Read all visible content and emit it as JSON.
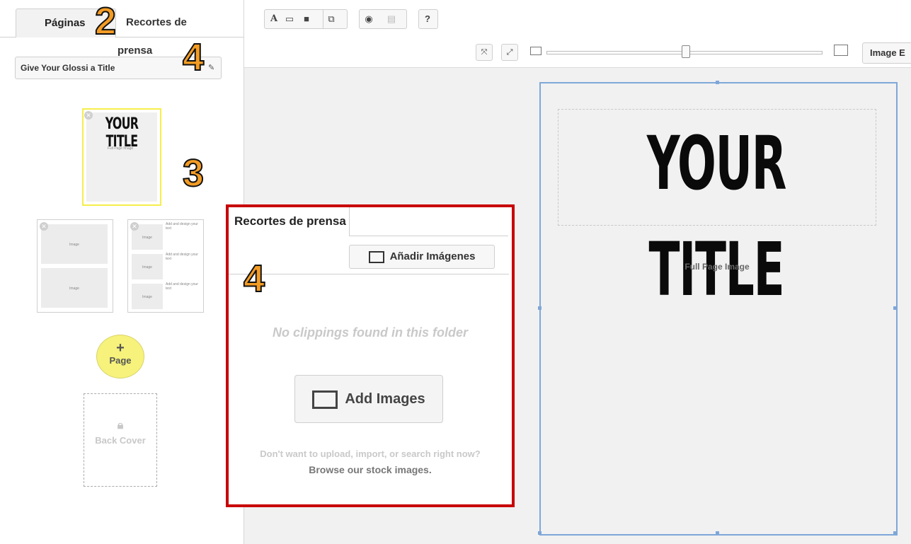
{
  "left_panel": {
    "tabs": {
      "pages": "Páginas",
      "clippings": "Recortes de prensa"
    },
    "title_input_value": "Give Your Glossi a Title",
    "cover_thumb": {
      "title": "YOUR TITLE",
      "caption": "Full Page Image"
    },
    "layout_thumb_1": {
      "labels": [
        "Image",
        "Image"
      ]
    },
    "layout_thumb_2": {
      "image_labels": [
        "Image",
        "Image",
        "Image"
      ],
      "text_labels": [
        "Add and design your text",
        "Add and design your text",
        "Add and design your text"
      ]
    },
    "add_page": {
      "plus": "+",
      "label": "Page"
    },
    "back_cover": "Back Cover"
  },
  "annotations": {
    "n2": "2",
    "n4_top": "4",
    "n3": "3",
    "n4_panel": "4"
  },
  "toolbar": {
    "text_glyph": "A",
    "image_edit_label": "Image E"
  },
  "canvas": {
    "page_title": "YOUR TITLE",
    "image_placeholder": "Full Page Image"
  },
  "clippings_panel": {
    "tab_label": "Recortes de prensa",
    "add_images_small": "Añadir Imágenes",
    "empty_message": "No clippings found in this folder",
    "add_images_large": "Add Images",
    "browse_line_1": "Don't want to upload, import, or search right now?",
    "browse_line_2": "Browse our stock images."
  },
  "colors": {
    "highlight": "#c80000",
    "annotation": "#f39c24",
    "selection": "#7ea7d8",
    "cover_border": "#f5ee4b"
  }
}
